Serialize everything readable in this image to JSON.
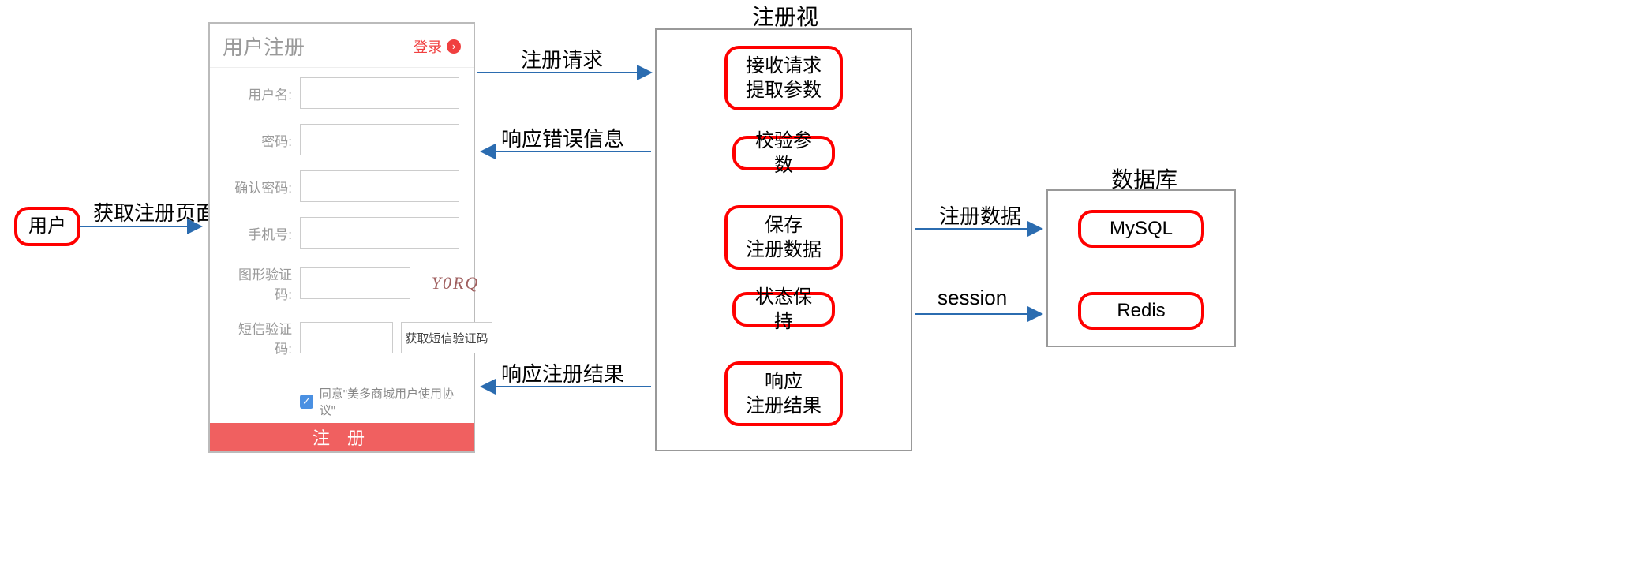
{
  "user_node": {
    "label": "用户"
  },
  "arrow_labels": {
    "get_page": "获取注册页面",
    "register_request": "注册请求",
    "error_response": "响应错误信息",
    "register_result": "响应注册结果",
    "register_data": "注册数据",
    "session": "session"
  },
  "view_container": {
    "title": "注册视图"
  },
  "view_steps": {
    "s1": "接收请求\n提取参数",
    "s2": "校验参数",
    "s3": "保存\n注册数据",
    "s4": "状态保持",
    "s5": "响应\n注册结果"
  },
  "db_container": {
    "title": "数据库"
  },
  "db_nodes": {
    "mysql": "MySQL",
    "redis": "Redis"
  },
  "form": {
    "title": "用户注册",
    "login_link": "登录",
    "fields": {
      "username": "用户名:",
      "password": "密码:",
      "confirm": "确认密码:",
      "phone": "手机号:",
      "captcha": "图形验证码:",
      "sms": "短信验证码:"
    },
    "captcha_text": "Y0RQ",
    "sms_btn": "获取短信验证码",
    "agree": "同意\"美多商城用户使用协议\"",
    "submit": "注 册"
  }
}
